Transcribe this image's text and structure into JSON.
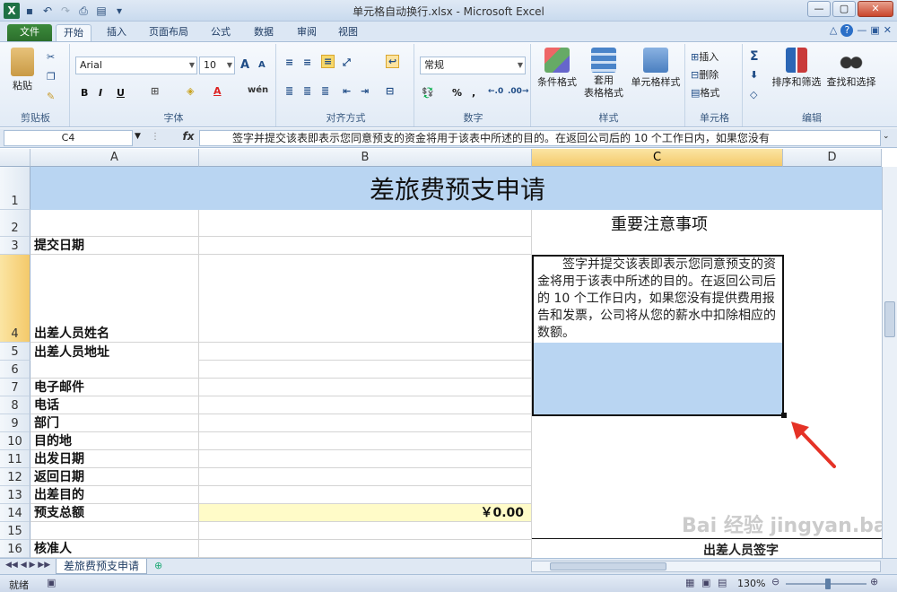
{
  "window": {
    "title": "单元格自动换行.xlsx - Microsoft Excel",
    "app_icon": "X",
    "controls": [
      "—",
      "▢",
      "✕"
    ]
  },
  "ribbon_tabs": [
    "文件",
    "开始",
    "插入",
    "页面布局",
    "公式",
    "数据",
    "审阅",
    "视图"
  ],
  "active_tab": "开始",
  "ribbon": {
    "clipboard": {
      "label": "剪贴板",
      "paste": "粘贴"
    },
    "font": {
      "label": "字体",
      "name": "Arial",
      "size": "10",
      "grow": "A",
      "shrink": "A",
      "bold": "B",
      "italic": "I",
      "underline": "U",
      "font_color": "A",
      "phonetic": "wén"
    },
    "align": {
      "label": "对齐方式"
    },
    "number": {
      "label": "数字",
      "format": "常规",
      "percent": "%",
      "comma": ","
    },
    "styles": {
      "label": "样式",
      "cond": "条件格式",
      "table1": "套用",
      "table2": "表格格式",
      "cellstyle": "单元格样式"
    },
    "cells": {
      "label": "单元格",
      "insert": "插入",
      "delete": "删除",
      "format": "格式"
    },
    "editing": {
      "label": "编辑",
      "sort": "排序和筛选",
      "find": "查找和选择"
    }
  },
  "formula_bar": {
    "name_box": "C4",
    "fx": "fx",
    "content": "签字并提交该表即表示您同意预支的资金将用于该表中所述的目的。在返回公司后的 10 个工作日内，如果您没有"
  },
  "columns": [
    "A",
    "B",
    "C",
    "D"
  ],
  "selected_column": "C",
  "rows": [
    "1",
    "2",
    "3",
    "4",
    "5",
    "6",
    "7",
    "8",
    "9",
    "10",
    "11",
    "12",
    "13",
    "14",
    "15",
    "16"
  ],
  "selected_row": "4",
  "sheet": {
    "title": "差旅费预支申请",
    "notice_title": "重要注意事项",
    "notice_text": "签字并提交该表即表示您同意预支的资金将用于该表中所述的目的。在返回公司后的 10 个工作日内，如果您没有提供费用报告和发票，公司将从您的薪水中扣除相应的数额。",
    "labels": [
      "提交日期",
      "出差人员姓名",
      "出差人员地址",
      "电子邮件",
      "电话",
      "部门",
      "目的地",
      "出发日期",
      "返回日期",
      "出差目的",
      "预支总额",
      "核准人"
    ],
    "total": "￥0.00",
    "signature_label": "出差人员签字"
  },
  "sheet_tab": "差旅费预支申请",
  "status": {
    "ready": "就绪",
    "zoom": "130%"
  },
  "watermark": "Bai 经验 jingyan.baidu.com",
  "colors": {
    "header_fill": "#b9d5f2",
    "total_fill": "#fffbc8",
    "annotation_arrow": "#e53226"
  }
}
